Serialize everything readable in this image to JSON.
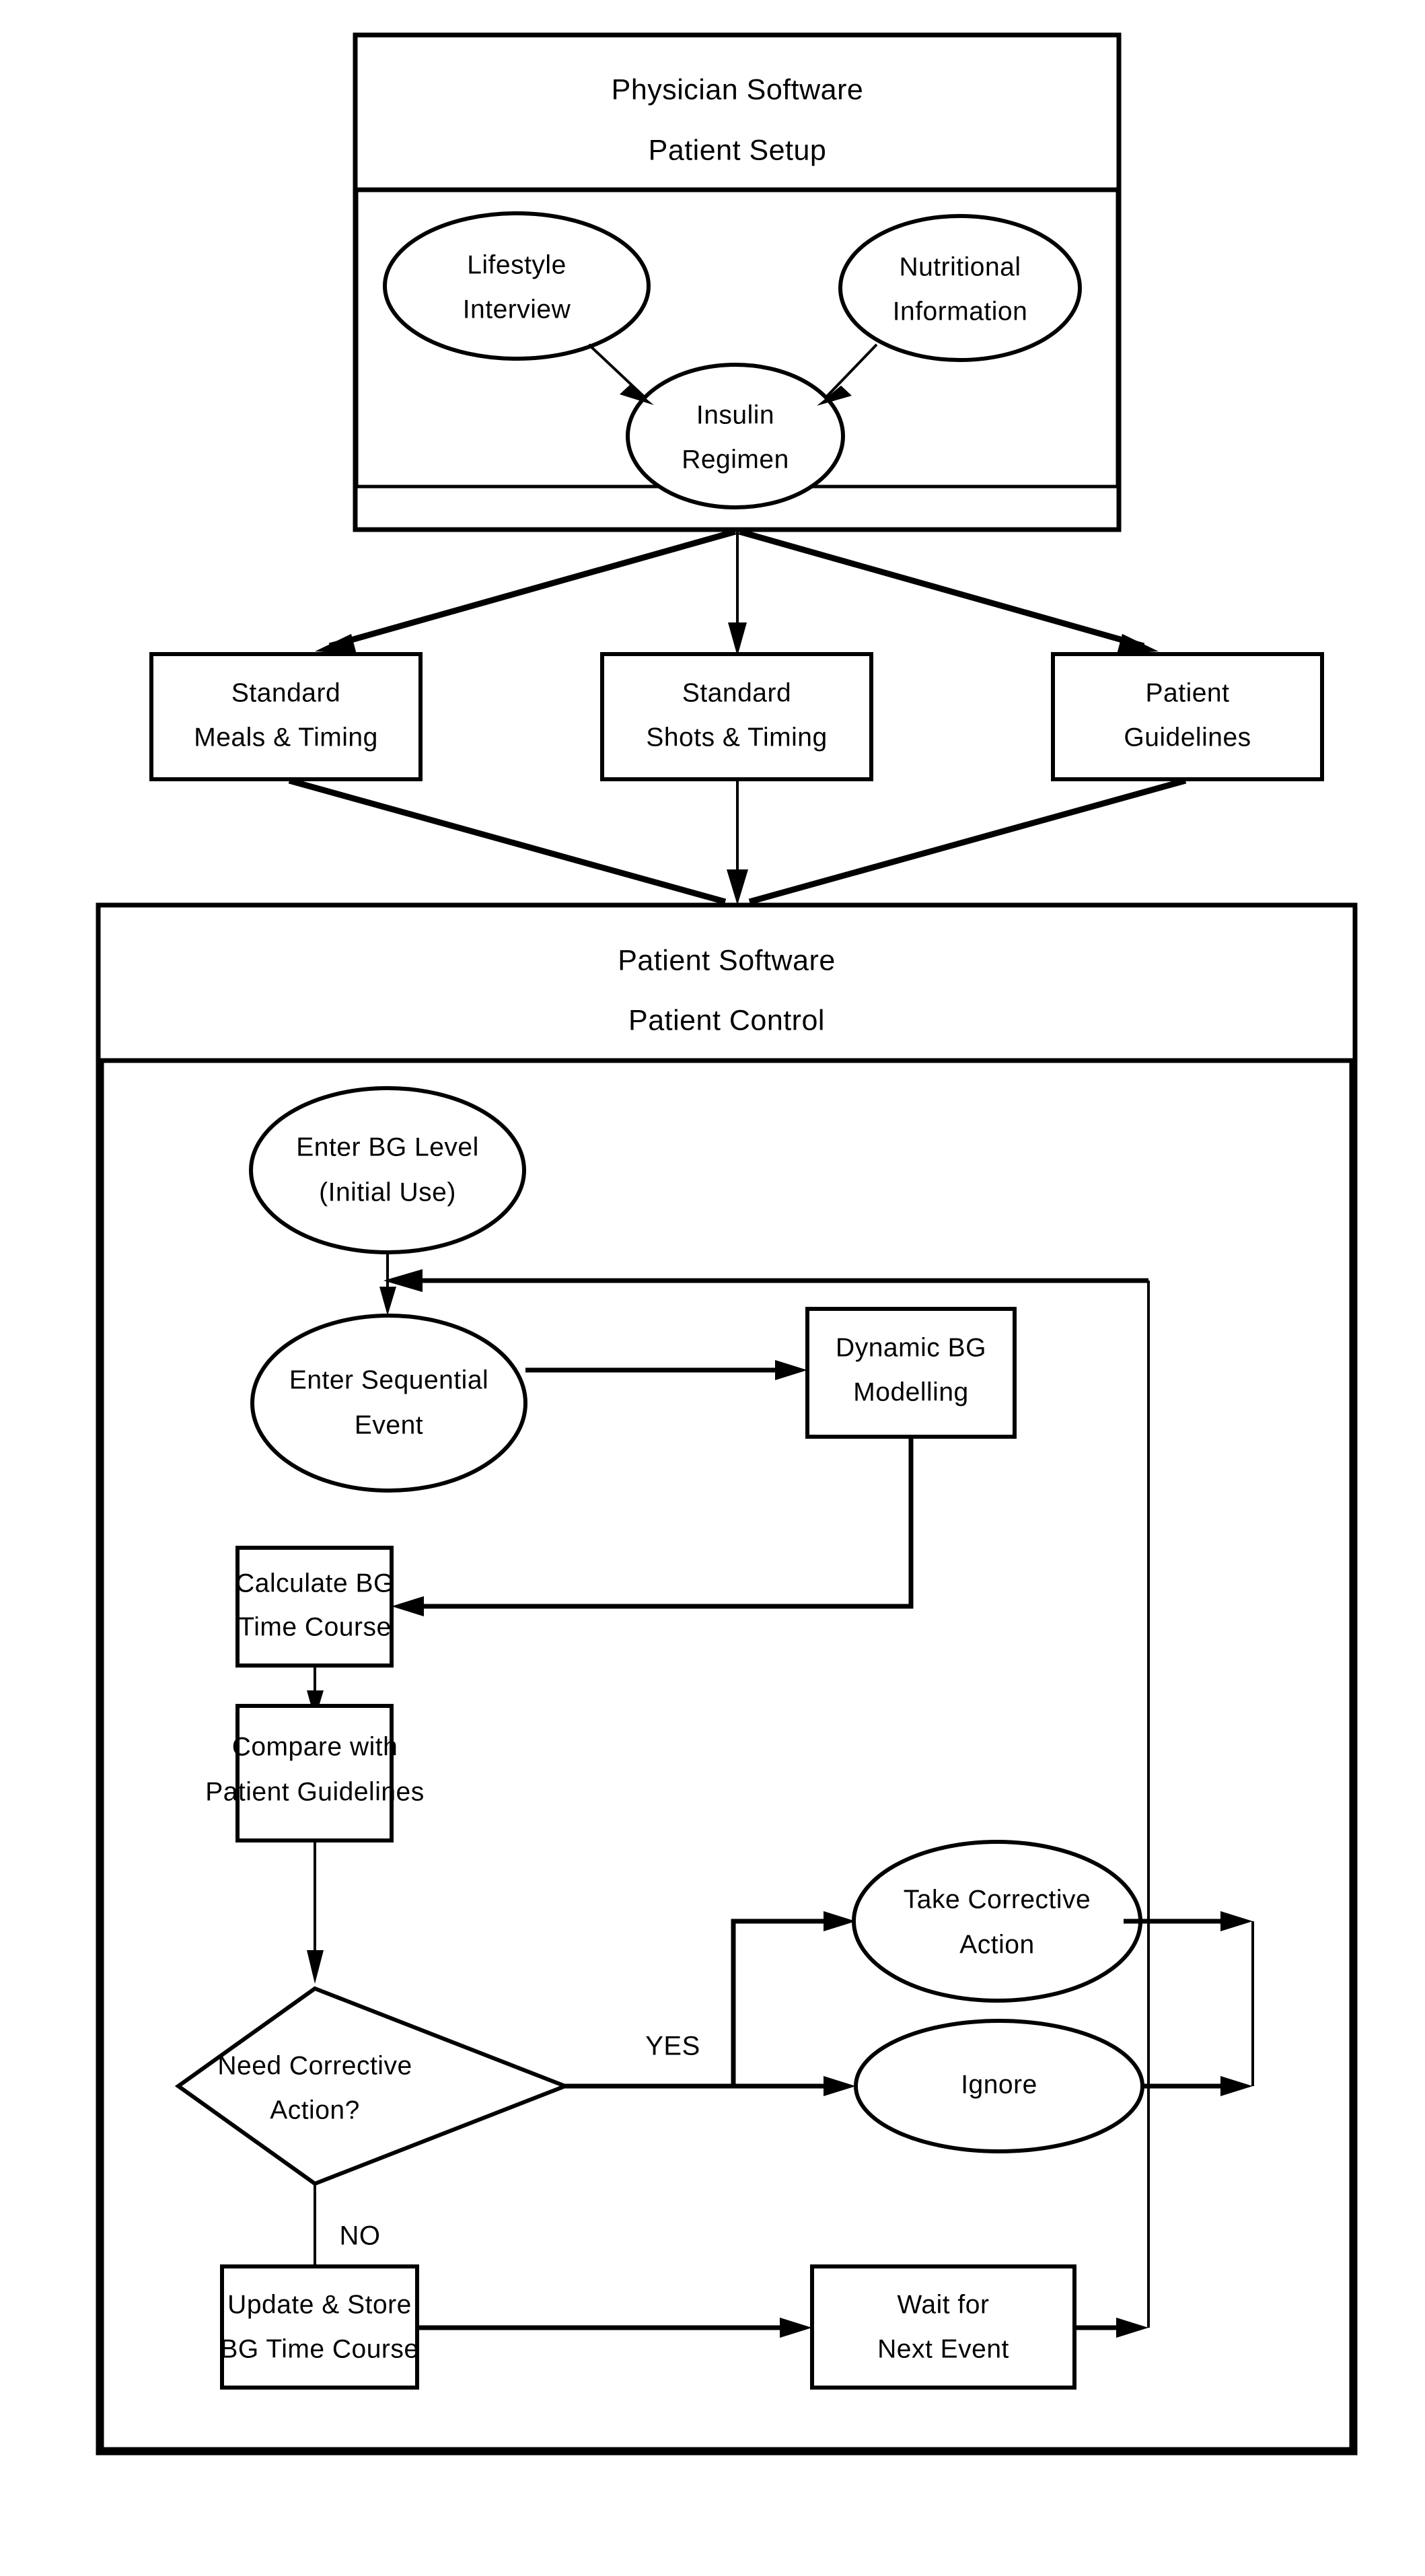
{
  "diagram": {
    "title": "Insulin Management Software Flowchart",
    "physician_section": {
      "header_line1": "Physician Software",
      "header_line2": "Patient Setup",
      "nodes": [
        {
          "id": "lifestyle-interview",
          "shape": "ellipse",
          "line1": "Lifestyle",
          "line2": "Interview"
        },
        {
          "id": "nutritional-information",
          "shape": "ellipse",
          "line1": "Nutritional",
          "line2": "Information"
        },
        {
          "id": "insulin-regimen",
          "shape": "ellipse",
          "line1": "Insulin",
          "line2": "Regimen"
        }
      ]
    },
    "outputs": [
      {
        "id": "standard-meals-timing",
        "line1": "Standard",
        "line2": "Meals  &  Timing"
      },
      {
        "id": "standard-shots-timing",
        "line1": "Standard",
        "line2": "Shots  &  Timing"
      },
      {
        "id": "patient-guidelines",
        "line1": "Patient",
        "line2": "Guidelines"
      }
    ],
    "patient_section": {
      "header_line1": "Patient Software",
      "header_line2": "Patient Control",
      "nodes": [
        {
          "id": "enter-bg-level",
          "shape": "ellipse",
          "line1": "Enter BG Level",
          "line2": "(Initial  Use)"
        },
        {
          "id": "enter-sequential-event",
          "shape": "ellipse",
          "line1": "Enter  Sequential",
          "line2": "Event"
        },
        {
          "id": "dynamic-bg-modelling",
          "shape": "rect",
          "line1": "Dynamic  BG",
          "line2": "Modelling"
        },
        {
          "id": "calculate-bg-time-course",
          "shape": "rect",
          "line1": "Calculate  BG",
          "line2": "Time  Course"
        },
        {
          "id": "compare-with-patient-guidelines",
          "shape": "rect",
          "line1": "Compare  with",
          "line2": "Patient  Guidelines"
        },
        {
          "id": "need-corrective-action",
          "shape": "diamond",
          "line1": "Need  Corrective",
          "line2": "Action?"
        },
        {
          "id": "take-corrective-action",
          "shape": "ellipse",
          "line1": "Take  Corrective",
          "line2": "Action"
        },
        {
          "id": "ignore",
          "shape": "ellipse",
          "line1": "Ignore",
          "line2": ""
        },
        {
          "id": "update-store-bg-time-course",
          "shape": "rect",
          "line1": "Update &  Store",
          "line2": "BG  Time  Course"
        },
        {
          "id": "wait-for-next-event",
          "shape": "rect",
          "line1": "Wait  for",
          "line2": "Next  Event"
        }
      ],
      "edge_labels": [
        {
          "id": "yes-label",
          "text": "YES"
        },
        {
          "id": "no-label",
          "text": "NO"
        }
      ]
    },
    "colors": {
      "stroke": "#000000",
      "fill": "#ffffff",
      "background": "#ffffff"
    }
  }
}
